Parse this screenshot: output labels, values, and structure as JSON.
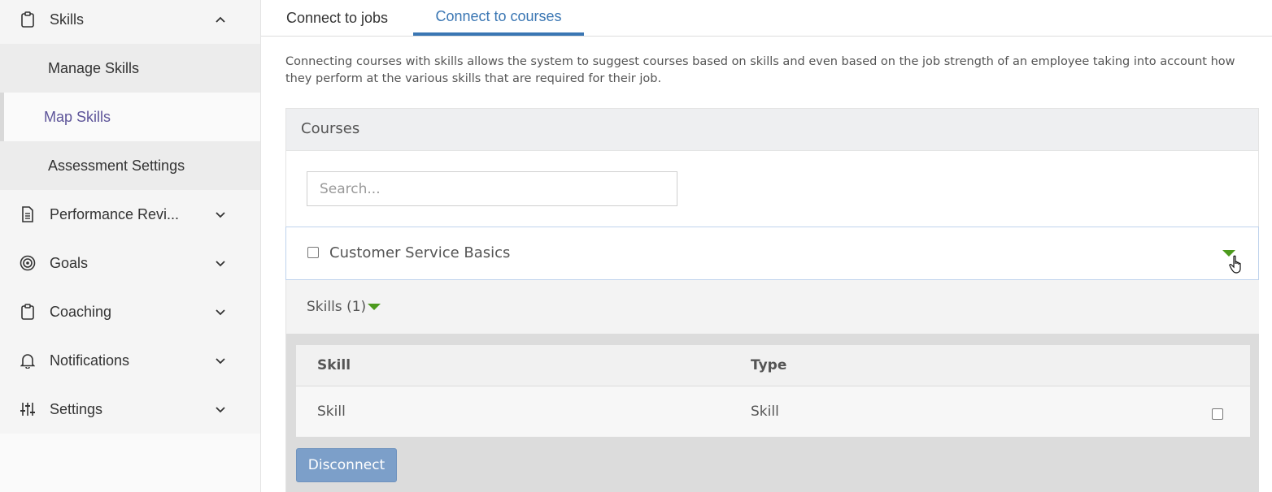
{
  "sidebar": {
    "skills": {
      "label": "Skills",
      "icon": "clipboard-icon",
      "expanded": true
    },
    "sub_items": [
      {
        "label": "Manage Skills"
      },
      {
        "label": "Map Skills",
        "active": true
      },
      {
        "label": "Assessment Settings"
      }
    ],
    "items": [
      {
        "label": "Performance Revi...",
        "icon": "document-icon"
      },
      {
        "label": "Goals",
        "icon": "target-icon"
      },
      {
        "label": "Coaching",
        "icon": "clipboard-icon"
      },
      {
        "label": "Notifications",
        "icon": "bell-icon"
      },
      {
        "label": "Settings",
        "icon": "sliders-icon"
      }
    ]
  },
  "tabs": [
    {
      "label": "Connect to jobs"
    },
    {
      "label": "Connect to courses",
      "active": true
    }
  ],
  "intro_text": "Connecting courses with skills allows the system to suggest courses based on skills and even based on the job strength of an employee taking into account how they perform at the various skills that are required for their job.",
  "courses": {
    "title": "Courses",
    "search_placeholder": "Search...",
    "course_name": "Customer Service Basics",
    "skills_label": "Skills (1)",
    "table": {
      "headers": [
        "Skill",
        "Type"
      ],
      "rows": [
        {
          "skill": "Skill",
          "type": "Skill"
        }
      ]
    },
    "disconnect_label": "Disconnect"
  },
  "colors": {
    "accent": "#3a76b3",
    "active_sub": "#5d5499",
    "triangle": "#4c9a1d",
    "button": "#7c9fc9"
  }
}
